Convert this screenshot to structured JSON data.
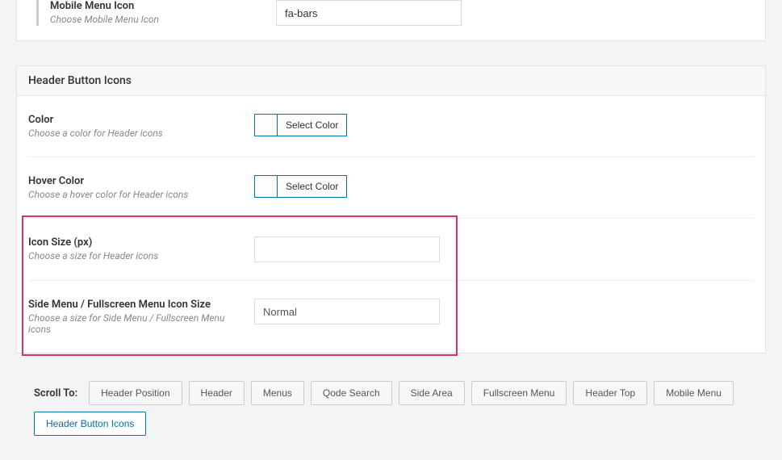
{
  "top_section": {
    "title": "Mobile Menu Icon",
    "desc": "Choose Mobile Menu Icon",
    "value": "fa-bars"
  },
  "panel": {
    "header": "Header Button Icons",
    "rows": {
      "color": {
        "title": "Color",
        "desc": "Choose a color for Header icons",
        "button": "Select Color"
      },
      "hover_color": {
        "title": "Hover Color",
        "desc": "Choose a hover color for Header icons",
        "button": "Select Color"
      },
      "icon_size": {
        "title": "Icon Size (px)",
        "desc": "Choose a size for Header icons",
        "value": ""
      },
      "side_menu_size": {
        "title": "Side Menu / Fullscreen Menu Icon Size",
        "desc": "Choose a size for Side Menu / Fullscreen Menu icons",
        "value": "Normal"
      }
    }
  },
  "scroll_to": {
    "label": "Scroll To:",
    "items": [
      "Header Position",
      "Header",
      "Menus",
      "Qode Search",
      "Side Area",
      "Fullscreen Menu",
      "Header Top",
      "Mobile Menu",
      "Header Button Icons"
    ],
    "active_index": 8
  }
}
